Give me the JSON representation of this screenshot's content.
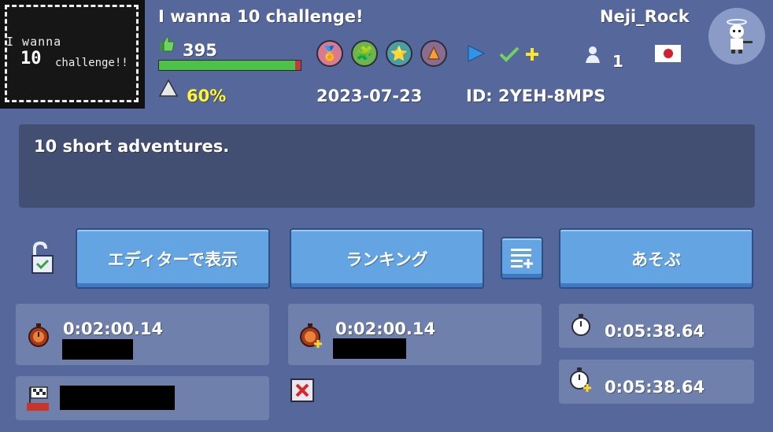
{
  "thumbnail": {
    "line1": "I wanna",
    "line2_num": "10",
    "line2_text": "challenge!!"
  },
  "level": {
    "title": "I wanna 10 challenge!",
    "author": "Neji_Rock",
    "likes": "395",
    "clear_rate": "60%",
    "like_ratio": 0.96,
    "date": "2023-07-23",
    "id": "ID: 2YEH-8MPS",
    "follow_count": "1",
    "description": "10 short adventures."
  },
  "tags": [
    {
      "icon": "medal-icon",
      "color": "#d77b95"
    },
    {
      "icon": "puzzle-icon",
      "color": "#6fb34b"
    },
    {
      "icon": "star-icon",
      "color": "#4a9ea8"
    },
    {
      "icon": "speedrun-icon",
      "color": "#8a6d8e"
    }
  ],
  "buttons": {
    "editor": "エディターで表示",
    "ranking": "ランキング",
    "play": "あそぶ"
  },
  "records": {
    "first_clear_time": "0:02:00.14",
    "best_time": "0:02:00.14",
    "timer1": "0:05:38.64",
    "timer2": "0:05:38.64"
  },
  "colors": {
    "background": "#56689b",
    "button": "#64a4e2",
    "accent_yellow": "#fff533",
    "bar_green": "#4cc24a",
    "bar_red": "#c13b3b"
  }
}
